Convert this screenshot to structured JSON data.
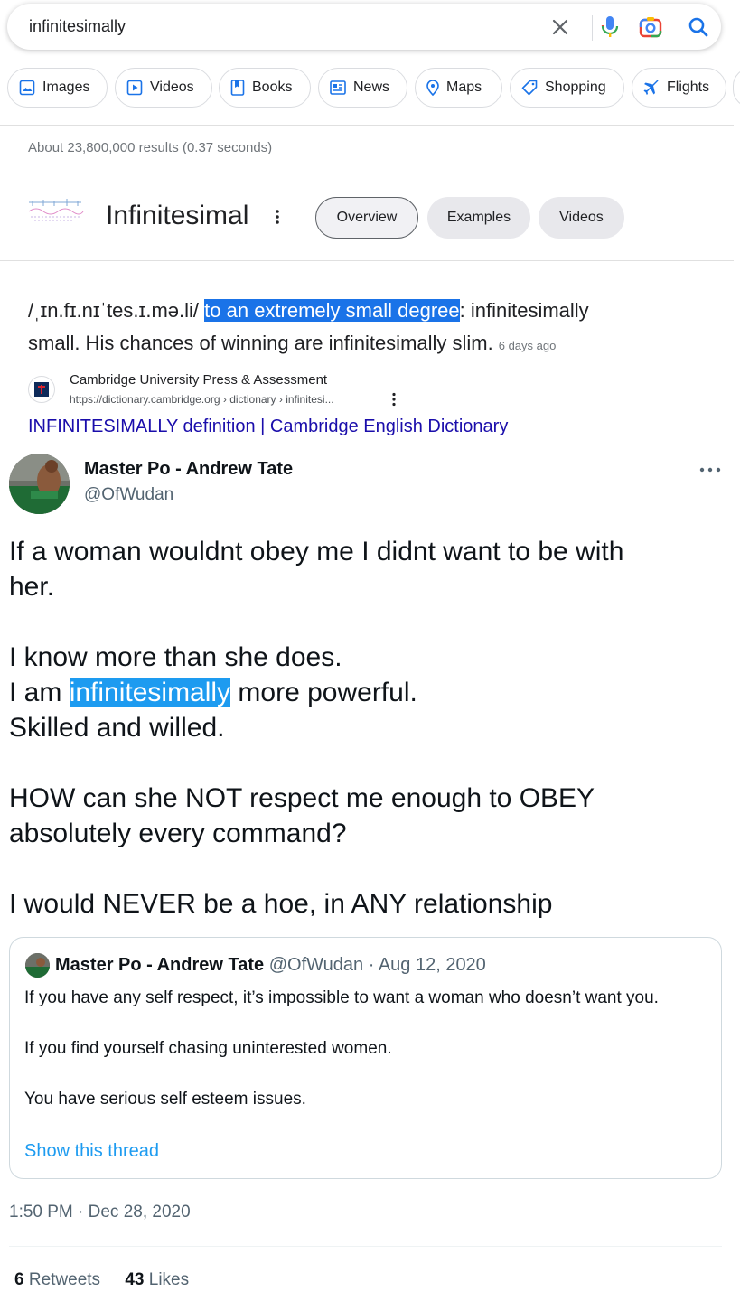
{
  "search": {
    "query": "infinitesimally",
    "icons": [
      "close-icon",
      "microphone-icon",
      "lens-camera-icon",
      "search-icon"
    ]
  },
  "chips": [
    {
      "label": "Images",
      "icon": "image-icon"
    },
    {
      "label": "Videos",
      "icon": "play-icon"
    },
    {
      "label": "Books",
      "icon": "book-icon"
    },
    {
      "label": "News",
      "icon": "newspaper-icon"
    },
    {
      "label": "Maps",
      "icon": "map-pin-icon"
    },
    {
      "label": "Shopping",
      "icon": "tag-icon"
    },
    {
      "label": "Flights",
      "icon": "plane-icon"
    }
  ],
  "stats": "About 23,800,000 results (0.37 seconds)",
  "knowledge_panel": {
    "title": "Infinitesimal",
    "tabs": [
      "Overview",
      "Examples",
      "Videos"
    ],
    "active_tab": "Overview"
  },
  "definition": {
    "pronunciation": "/ˌɪn.fɪ.nɪˈtes.ɪ.mə.li/",
    "highlight": "to an extremely small degree",
    "rest_line1": ": infinitesimally",
    "line2": "small. His chances of winning are infinitesimally slim.",
    "date": "6 days ago"
  },
  "source": {
    "name": "Cambridge University Press & Assessment",
    "url": "https://dictionary.cambridge.org › dictionary › infinitesi...",
    "link_text": "INFINITESIMALLY definition | Cambridge English Dictionary"
  },
  "tweet": {
    "name": "Master Po - Andrew Tate",
    "handle": "@OfWudan",
    "body": {
      "l1": "If a woman wouldnt obey me I didnt want to be with",
      "l2": "her.",
      "l3": "I know more than she does.",
      "l4_pre": "I am ",
      "l4_hl": "infinitesimally",
      "l4_post": " more powerful.",
      "l5": "Skilled and willed.",
      "l6": "HOW can she NOT respect me enough to OBEY",
      "l7": "absolutely every command?",
      "l8": "I would NEVER be a hoe, in ANY relationship"
    },
    "quote": {
      "name": "Master Po - Andrew Tate",
      "meta": "@OfWudan · Aug 12, 2020",
      "p1": "If you have any self respect, it’s impossible to want a woman who doesn’t want you.",
      "p2": "If you find yourself chasing uninterested women.",
      "p3": "You have serious self esteem issues.",
      "show_thread": "Show this thread"
    },
    "timestamp": "1:50 PM · Dec 28, 2020",
    "retweets_count": "6",
    "retweets_label": "Retweets",
    "likes_count": "43",
    "likes_label": "Likes"
  }
}
